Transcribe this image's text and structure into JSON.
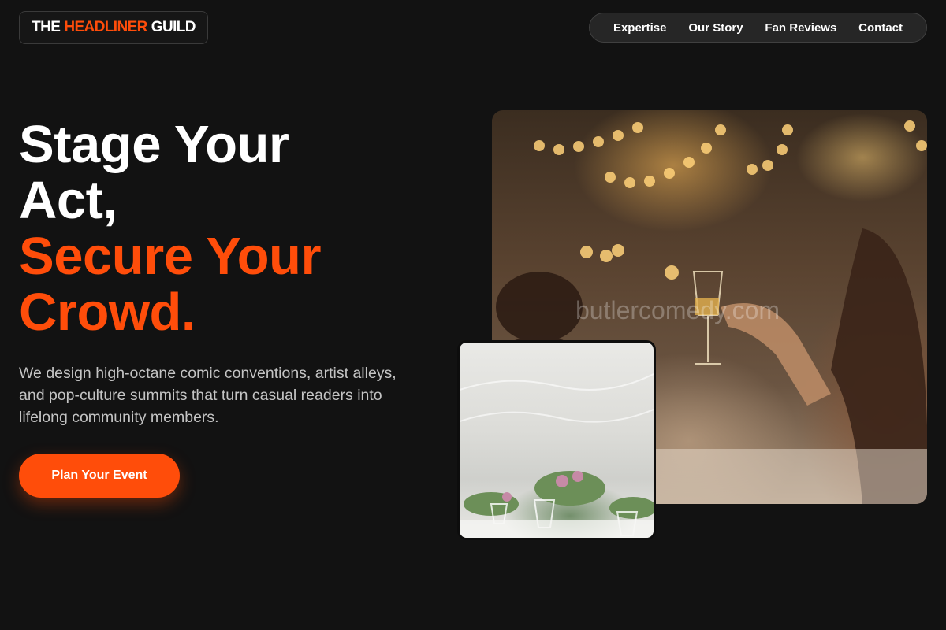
{
  "header": {
    "logo": {
      "part1": "THE",
      "part2": "HEADLINER",
      "part3": "GUILD"
    },
    "nav": [
      {
        "label": "Expertise"
      },
      {
        "label": "Our Story"
      },
      {
        "label": "Fan Reviews"
      },
      {
        "label": "Contact"
      }
    ]
  },
  "hero": {
    "headline_white_1": "Stage Your",
    "headline_white_2": "Act,",
    "headline_accent_1": "Secure Your",
    "headline_accent_2": "Crowd.",
    "subtitle": "We design high-octane comic conventions, artist alleys, and pop-culture summits that turn casual readers into lifelong community members.",
    "cta_label": "Plan Your Event"
  },
  "images": {
    "main_watermark": "butlercomedy.com"
  },
  "colors": {
    "accent": "#ff4d0a",
    "background": "#121212",
    "nav_background": "#262626"
  }
}
